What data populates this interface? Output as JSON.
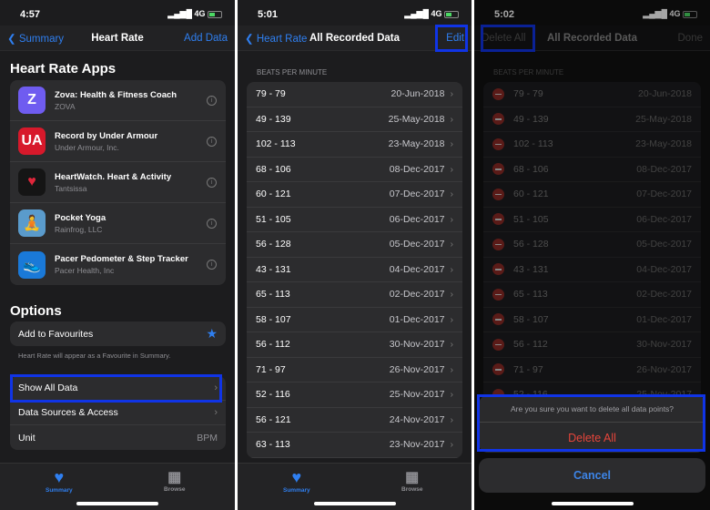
{
  "screen1": {
    "time": "4:57",
    "signal": "4G",
    "nav": {
      "back": "Summary",
      "title": "Heart Rate",
      "action": "Add Data"
    },
    "apps_title": "Heart Rate Apps",
    "apps": [
      {
        "name": "Zova: Health & Fitness Coach",
        "dev": "ZOVA",
        "icon": "Z",
        "color": "#6f5cf0"
      },
      {
        "name": "Record by Under Armour",
        "dev": "Under Armour, Inc.",
        "icon": "UA",
        "color": "#d7192b"
      },
      {
        "name": "HeartWatch. Heart & Activity",
        "dev": "Tantsissa",
        "icon": "♥",
        "color": "#151515"
      },
      {
        "name": "Pocket Yoga",
        "dev": "Rainfrog, LLC",
        "icon": "🧘",
        "color": "#5a9bcc"
      },
      {
        "name": "Pacer Pedometer & Step Tracker",
        "dev": "Pacer Health, Inc",
        "icon": "👟",
        "color": "#1a79d8"
      }
    ],
    "options_title": "Options",
    "favourite": "Add to Favourites",
    "favourite_note": "Heart Rate will appear as a Favourite in Summary.",
    "show_all": "Show All Data",
    "sources": "Data Sources & Access",
    "unit_label": "Unit",
    "unit_value": "BPM"
  },
  "tabs": {
    "summary": "Summary",
    "browse": "Browse"
  },
  "screen2": {
    "time": "5:01",
    "signal": "4G",
    "nav": {
      "back": "Heart Rate",
      "title": "All Recorded Data",
      "action": "Edit"
    },
    "section": "BEATS PER MINUTE"
  },
  "screen3": {
    "time": "5:02",
    "signal": "4G",
    "nav": {
      "left": "Delete All",
      "title": "All Recorded Data",
      "right": "Done"
    },
    "section": "BEATS PER MINUTE",
    "sheet": {
      "message": "Are you sure you want to delete all data points?",
      "delete": "Delete All",
      "cancel": "Cancel"
    }
  },
  "records": [
    {
      "bpm": "79 - 79",
      "date": "20-Jun-2018"
    },
    {
      "bpm": "49 - 139",
      "date": "25-May-2018"
    },
    {
      "bpm": "102 - 113",
      "date": "23-May-2018"
    },
    {
      "bpm": "68 - 106",
      "date": "08-Dec-2017"
    },
    {
      "bpm": "60 - 121",
      "date": "07-Dec-2017"
    },
    {
      "bpm": "51 - 105",
      "date": "06-Dec-2017"
    },
    {
      "bpm": "56 - 128",
      "date": "05-Dec-2017"
    },
    {
      "bpm": "43 - 131",
      "date": "04-Dec-2017"
    },
    {
      "bpm": "65 - 113",
      "date": "02-Dec-2017"
    },
    {
      "bpm": "58 - 107",
      "date": "01-Dec-2017"
    },
    {
      "bpm": "56 - 112",
      "date": "30-Nov-2017"
    },
    {
      "bpm": "71 - 97",
      "date": "26-Nov-2017"
    },
    {
      "bpm": "52 - 116",
      "date": "25-Nov-2017"
    },
    {
      "bpm": "56 - 121",
      "date": "24-Nov-2017"
    },
    {
      "bpm": "63 - 113",
      "date": "23-Nov-2017"
    }
  ],
  "colors": {
    "accent": "#2f7ff0",
    "destructive": "#e5453b",
    "highlight": "#1034e6"
  }
}
